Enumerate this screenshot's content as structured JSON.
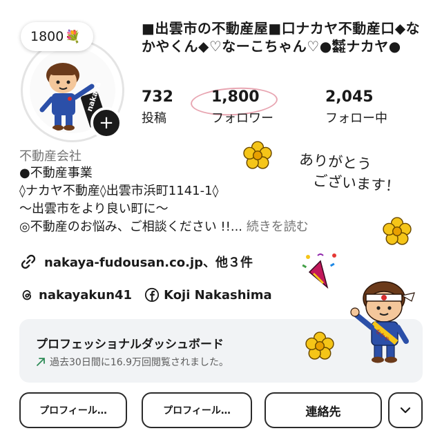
{
  "note": {
    "count": "1800",
    "emoji": "💐"
  },
  "profile": {
    "title": "■出雲市の不動産屋■口ナカヤ不動産口◆なかやくん◆♡なーこちゃん♡●㍿ナカヤ●",
    "avatar_text": "nakaya",
    "plus": "+"
  },
  "stats": [
    {
      "value": "732",
      "label": "投稿"
    },
    {
      "value": "1,800",
      "label": "フォロワー"
    },
    {
      "value": "2,045",
      "label": "フォロー中"
    }
  ],
  "bio": {
    "category": "不動産会社",
    "lines": [
      "●不動産事業",
      "◊ナカヤ不動産◊出雲市浜町1141-1◊",
      "〜出雲市をより良い町に〜",
      "◎不動産のお悩み、ご相談ください !!..."
    ],
    "more": "続きを読む"
  },
  "link": {
    "text": "nakaya-fudousan.co.jp、他３件"
  },
  "social": {
    "threads": "nakayakun41",
    "facebook": "Koji Nakashima"
  },
  "dashboard": {
    "title": "プロフェッショナルダッシュボード",
    "subtitle": "過去30日間に16.9万回閲覧されました。"
  },
  "buttons": {
    "edit": "プロフィール…",
    "share": "プロフィール…",
    "contact": "連絡先",
    "more_icon": "chevron-down"
  },
  "decor": {
    "thanks_line1": "ありがとう",
    "thanks_line2": "ございます！",
    "sash_text": "なかや"
  },
  "colors": {
    "flower": "#f5c518",
    "flower_center": "#e8a000",
    "accent_pink": "#e8a6b2",
    "trend_green": "#2e8b57"
  }
}
